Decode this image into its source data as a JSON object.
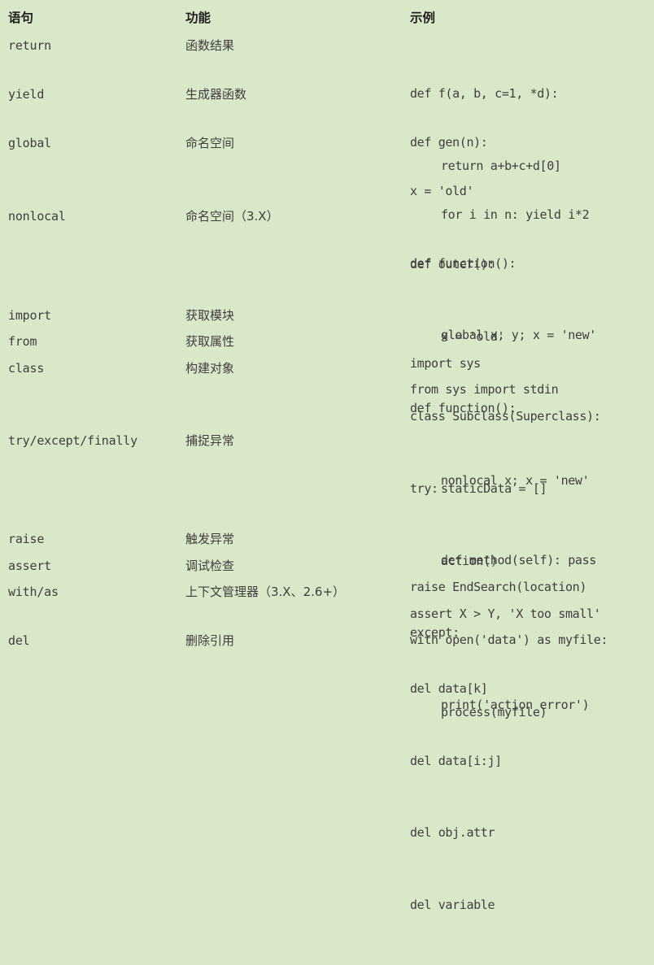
{
  "table": {
    "headers": {
      "statement": "语句",
      "function": "功能",
      "example": "示例"
    },
    "rows": [
      {
        "statement": "return",
        "function": "函数结果",
        "example": [
          "def f(a, b, c=1, *d):",
          "return a+b+c+d[0]"
        ]
      },
      {
        "statement": "yield",
        "function": "生成器函数",
        "example": [
          "def gen(n):",
          "for i in n: yield i*2"
        ]
      },
      {
        "statement": "global",
        "function": "命名空间",
        "example": [
          "x = 'old'",
          "def function():",
          "global x, y; x = 'new'"
        ]
      },
      {
        "statement": "nonlocal",
        "function": "命名空间（3.X）",
        "example": [
          "def outer():",
          "x = 'old'",
          "def function():",
          "nonlocal x; x = 'new'"
        ]
      },
      {
        "statement": "import",
        "function": "获取模块",
        "example": [
          "import sys"
        ]
      },
      {
        "statement": "from",
        "function": "获取属性",
        "example": [
          "from sys import stdin"
        ]
      },
      {
        "statement": "class",
        "function": "构建对象",
        "example": [
          "class Subclass(Superclass):",
          "staticData = []",
          "def method(self): pass"
        ]
      },
      {
        "statement": "try/except/finally",
        "function": "捕捉异常",
        "example": [
          "try:",
          "action()",
          "except:",
          "print('action error')"
        ]
      },
      {
        "statement": "raise",
        "function": "触发异常",
        "example": [
          "raise EndSearch(location)"
        ]
      },
      {
        "statement": "assert",
        "function": "调试检查",
        "example": [
          "assert X > Y, 'X too small'"
        ]
      },
      {
        "statement": "with/as",
        "function": "上下文管理器（3.X、2.6+）",
        "example": [
          "with open('data') as myfile:",
          "process(myfile)"
        ]
      },
      {
        "statement": "del",
        "function": "删除引用",
        "example": [
          "del data[k]",
          "del data[i:j]",
          "del obj.attr",
          "del variable"
        ]
      }
    ]
  }
}
